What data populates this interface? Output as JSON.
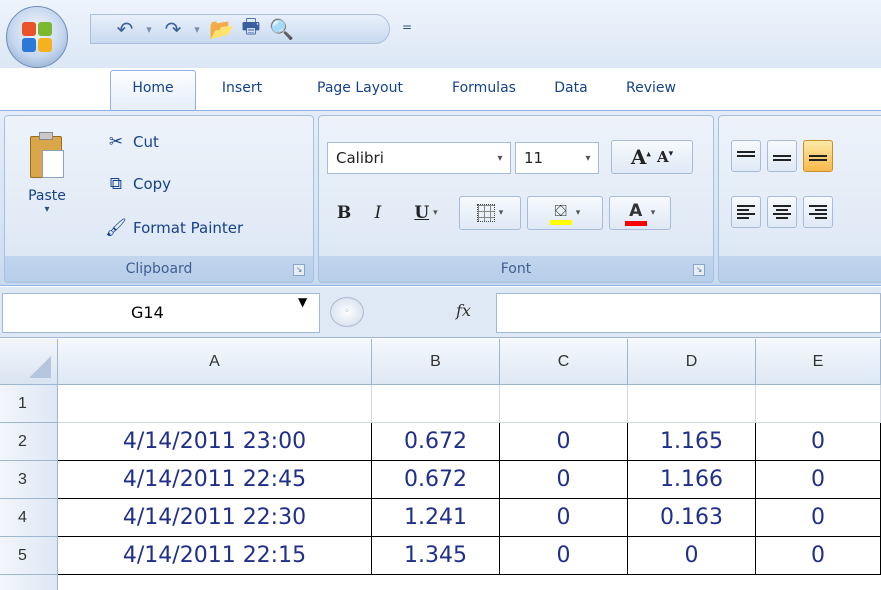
{
  "quick_access": {
    "items": [
      {
        "icon": "undo-icon",
        "glyph": "↶"
      },
      {
        "icon": "undo-dropdown-icon",
        "glyph": "▾",
        "small": true
      },
      {
        "icon": "redo-icon",
        "glyph": "↷"
      },
      {
        "icon": "redo-dropdown-icon",
        "glyph": "▾",
        "small": true
      },
      {
        "icon": "open-folder-icon",
        "glyph": "📂"
      },
      {
        "icon": "print-icon",
        "glyph": "🖶"
      },
      {
        "icon": "print-preview-icon",
        "glyph": "🔍"
      }
    ],
    "customize_glyph": "="
  },
  "tabs": [
    {
      "label": "Home",
      "active": true
    },
    {
      "label": "Insert",
      "active": false
    },
    {
      "label": "Page Layout",
      "active": false
    },
    {
      "label": "Formulas",
      "active": false
    },
    {
      "label": "Data",
      "active": false
    },
    {
      "label": "Review",
      "active": false
    }
  ],
  "clipboard": {
    "paste_label": "Paste",
    "cut_label": "Cut",
    "copy_label": "Copy",
    "format_painter_label": "Format Painter",
    "group_label": "Clipboard"
  },
  "font": {
    "font_name": "Calibri",
    "font_size": "11",
    "grow_label": "A",
    "shrink_label": "A",
    "bold_label": "B",
    "italic_label": "I",
    "underline_label": "U",
    "font_color_label": "A",
    "group_label": "Font",
    "fill_color": "#ffff00",
    "font_color": "#ff0000"
  },
  "formula_bar": {
    "name_box": "G14",
    "fx_label": "fx",
    "formula": ""
  },
  "sheet": {
    "columns": [
      "A",
      "B",
      "C",
      "D",
      "E"
    ],
    "rows": [
      {
        "num": "1",
        "cells": [
          "",
          "",
          "",
          "",
          ""
        ]
      },
      {
        "num": "2",
        "cells": [
          "4/14/2011 23:00",
          "0.672",
          "0",
          "1.165",
          "0"
        ]
      },
      {
        "num": "3",
        "cells": [
          "4/14/2011 22:45",
          "0.672",
          "0",
          "1.166",
          "0"
        ]
      },
      {
        "num": "4",
        "cells": [
          "4/14/2011 22:30",
          "1.241",
          "0",
          "0.163",
          "0"
        ]
      },
      {
        "num": "5",
        "cells": [
          "4/14/2011 22:15",
          "1.345",
          "0",
          "0",
          "0"
        ]
      }
    ]
  }
}
